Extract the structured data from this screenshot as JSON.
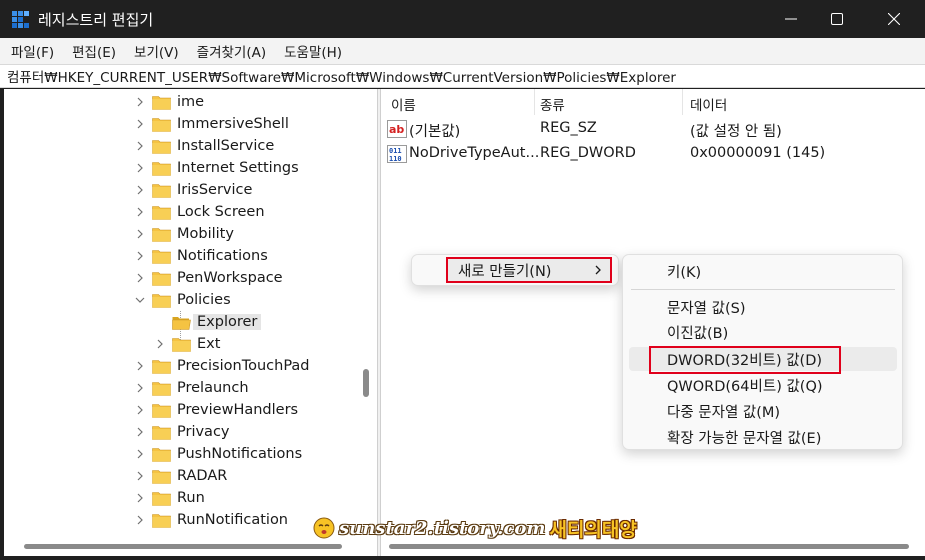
{
  "window": {
    "title": "레지스트리 편집기",
    "icon": "registry-editor-icon"
  },
  "menu": [
    "파일(F)",
    "편집(E)",
    "보기(V)",
    "즐겨찾기(A)",
    "도움말(H)"
  ],
  "address": "컴퓨터₩HKEY_CURRENT_USER₩Software₩Microsoft₩Windows₩CurrentVersion₩Policies₩Explorer",
  "tree": {
    "items": [
      {
        "label": "ime",
        "expander": "collapsed"
      },
      {
        "label": "ImmersiveShell",
        "expander": "collapsed"
      },
      {
        "label": "InstallService",
        "expander": "collapsed"
      },
      {
        "label": "Internet Settings",
        "expander": "collapsed"
      },
      {
        "label": "IrisService",
        "expander": "collapsed"
      },
      {
        "label": "Lock Screen",
        "expander": "collapsed"
      },
      {
        "label": "Mobility",
        "expander": "collapsed"
      },
      {
        "label": "Notifications",
        "expander": "collapsed"
      },
      {
        "label": "PenWorkspace",
        "expander": "collapsed"
      },
      {
        "label": "Policies",
        "expander": "expanded"
      },
      {
        "label": "Explorer",
        "expander": "none",
        "selected": true,
        "open": true
      },
      {
        "label": "Ext",
        "expander": "collapsed"
      },
      {
        "label": "PrecisionTouchPad",
        "expander": "collapsed"
      },
      {
        "label": "Prelaunch",
        "expander": "collapsed"
      },
      {
        "label": "PreviewHandlers",
        "expander": "collapsed"
      },
      {
        "label": "Privacy",
        "expander": "collapsed"
      },
      {
        "label": "PushNotifications",
        "expander": "collapsed"
      },
      {
        "label": "RADAR",
        "expander": "collapsed"
      },
      {
        "label": "Run",
        "expander": "collapsed"
      },
      {
        "label": "RunNotification",
        "expander": "collapsed"
      }
    ]
  },
  "list": {
    "columns": [
      "이름",
      "종류",
      "데이터"
    ],
    "rows": [
      {
        "name": "(기본값)",
        "type": "REG_SZ",
        "data": "(값 설정 안 됨)",
        "icon": "string-value-icon"
      },
      {
        "name": "NoDriveTypeAut...",
        "type": "REG_DWORD",
        "data": "0x00000091 (145)",
        "icon": "binary-value-icon"
      }
    ]
  },
  "context_menu": {
    "new_label": "새로 만들기(N)",
    "submenu": [
      "키(K)",
      "문자열 값(S)",
      "이진값(B)",
      "DWORD(32비트) 값(D)",
      "QWORD(64비트) 값(Q)",
      "다중 문자열 값(M)",
      "확장 가능한 문자열 값(E)"
    ]
  },
  "watermark": {
    "url": "sunstar2.tistory.com",
    "name": "새티의태양"
  },
  "colors": {
    "highlight_box": "#e0001b",
    "folder": "#f5c342",
    "titlebar": "#202020"
  }
}
